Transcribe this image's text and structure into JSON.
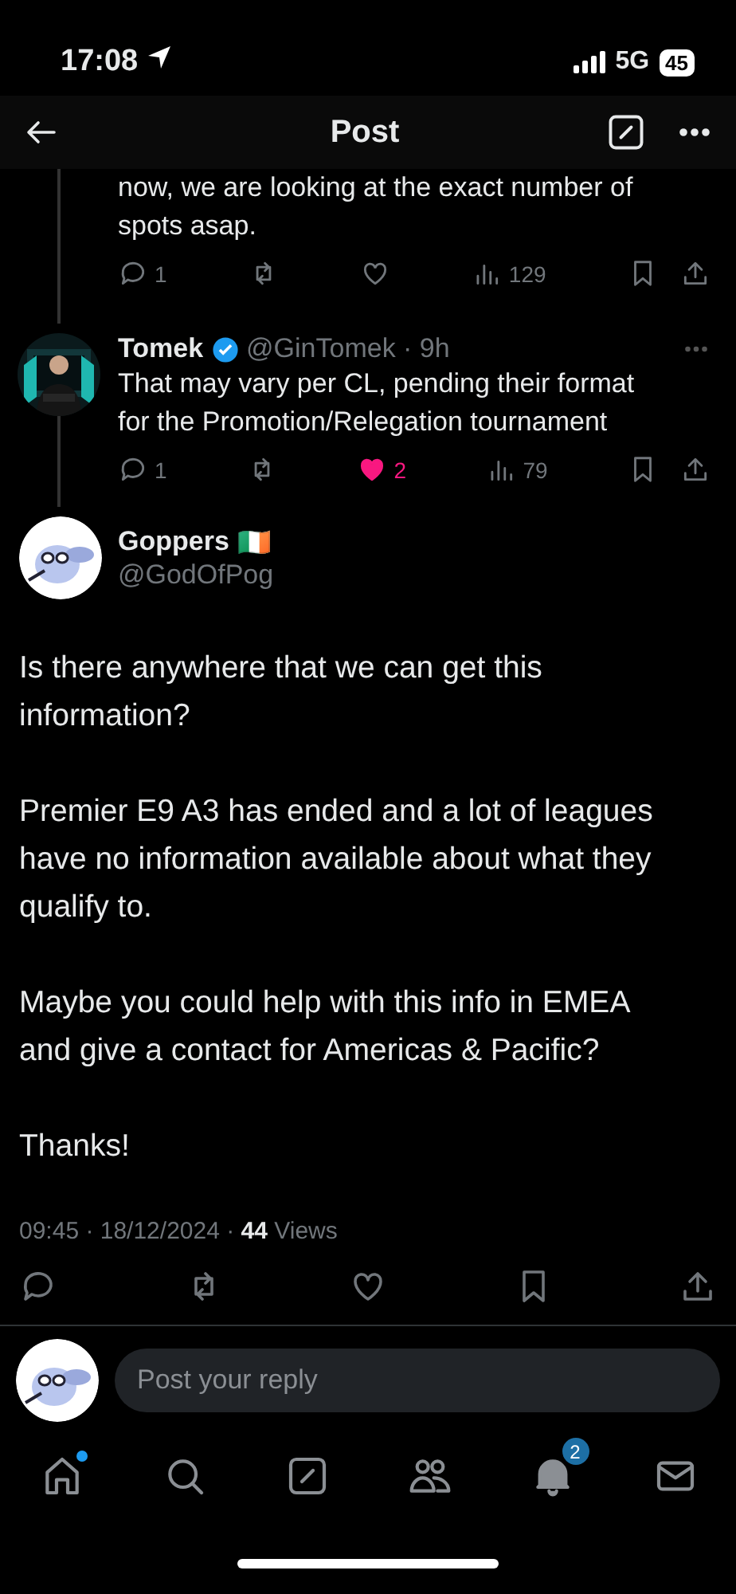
{
  "status_bar": {
    "time": "17:08",
    "network": "5G",
    "battery": "45"
  },
  "header": {
    "title": "Post"
  },
  "replies": [
    {
      "kind": "fragment",
      "lines": [
        "now, we are looking at the exact number of",
        "spots asap."
      ],
      "stats": {
        "replies": "1",
        "liked": false,
        "views": "129"
      }
    },
    {
      "kind": "full",
      "name": "Tomek",
      "verified": true,
      "handle": "@GinTomek · 9h",
      "text": "That may vary per CL, pending their format for the Promotion/Relegation tournament",
      "stats": {
        "replies": "1",
        "likes": "2",
        "liked": true,
        "views": "79"
      }
    }
  ],
  "post": {
    "name": "Goppers",
    "flag": "🇮🇪",
    "handle": "@GodOfPog",
    "paragraphs": [
      "Is there anywhere that we can get this information?",
      "Premier E9 A3 has ended and a lot of leagues have no information available about what they qualify to.",
      "Maybe you could help with this info in EMEA and give a contact for Americas & Pacific?",
      "Thanks!"
    ],
    "meta": "09:45 · 18/12/2024 · **44** Views"
  },
  "reply_box": {
    "placeholder": "Post your reply"
  },
  "nav": [
    {
      "kind": "home",
      "dot": true
    },
    {
      "kind": "search"
    },
    {
      "kind": "compose"
    },
    {
      "kind": "communities"
    },
    {
      "kind": "notifications",
      "badge": "2"
    },
    {
      "kind": "messages"
    }
  ]
}
